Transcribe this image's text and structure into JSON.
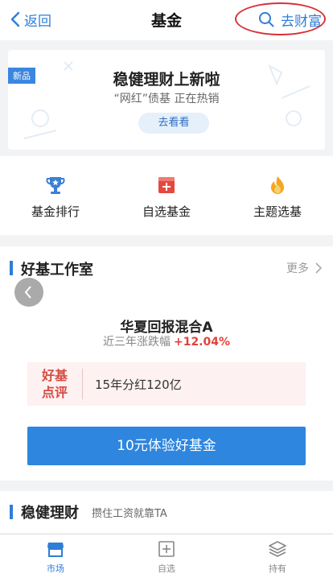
{
  "nav": {
    "back_label": "返回",
    "title": "基金",
    "right_label": "去财富"
  },
  "banner": {
    "tag": "新品",
    "title": "稳健理财上新啦",
    "subtitle": "“网红”债基  正在热销",
    "button": "去看看"
  },
  "quick_actions": [
    {
      "label": "基金排行",
      "icon": "trophy-icon"
    },
    {
      "label": "自选基金",
      "icon": "plus-box-icon"
    },
    {
      "label": "主题选基",
      "icon": "flame-icon"
    }
  ],
  "studio": {
    "title": "好基工作室",
    "more": "更多",
    "fund_name": "华夏回报混合A",
    "rate_label": "近三年涨跌幅",
    "rate_value": "+12.04%",
    "review_tag_line1": "好基",
    "review_tag_line2": "点评",
    "review_text": "15年分红120亿",
    "cta": "10元体验好基金"
  },
  "steady": {
    "title": "稳健理财",
    "subtitle": "攒住工资就靠TA"
  },
  "tabbar": {
    "items": [
      {
        "label": "市场",
        "icon": "store-icon",
        "active": true
      },
      {
        "label": "自选",
        "icon": "plus-square-icon",
        "active": false
      },
      {
        "label": "持有",
        "icon": "layers-icon",
        "active": false
      }
    ]
  },
  "colors": {
    "accent": "#2f7ed8",
    "highlight_ring": "#d8323a",
    "rate_positive": "#e0433b",
    "cta_bg": "#2e86de"
  }
}
